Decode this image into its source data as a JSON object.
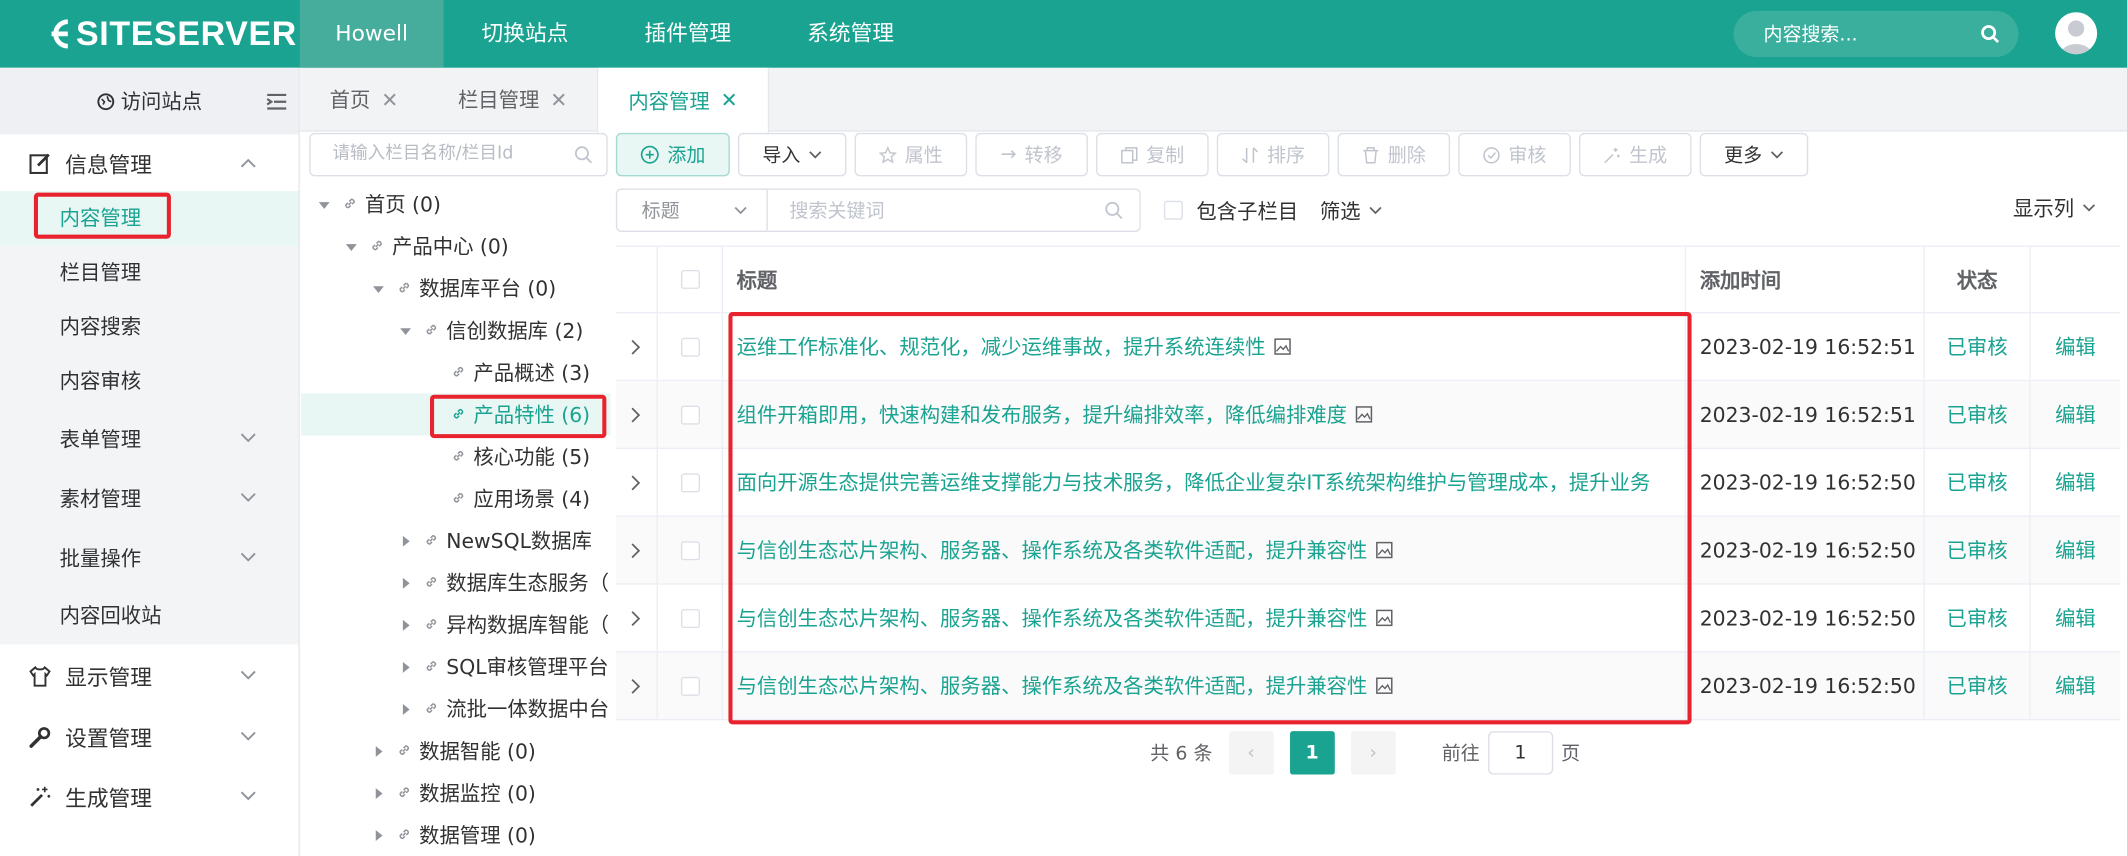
{
  "brand": {
    "logo_text": "SITESERVER"
  },
  "topnav": {
    "items": [
      "Howell",
      "切换站点",
      "插件管理",
      "系统管理"
    ]
  },
  "global_search": {
    "placeholder": "内容搜索..."
  },
  "sidebar": {
    "visit": "访问站点",
    "sections": [
      {
        "label": "信息管理",
        "icon": "edit-icon",
        "expanded": true
      },
      {
        "label": "显示管理",
        "icon": "shirt-icon"
      },
      {
        "label": "设置管理",
        "icon": "wrench-icon"
      },
      {
        "label": "生成管理",
        "icon": "magic-wand-icon"
      }
    ],
    "info_items": [
      "内容管理",
      "栏目管理",
      "内容搜索",
      "内容审核"
    ],
    "info_groups": [
      "表单管理",
      "素材管理",
      "批量操作"
    ],
    "recycle": "内容回收站"
  },
  "tabs": [
    {
      "label": "首页"
    },
    {
      "label": "栏目管理"
    },
    {
      "label": "内容管理",
      "active": true
    }
  ],
  "tree": {
    "search_placeholder": "请输入栏目名称/栏目Id",
    "nodes": [
      {
        "label": "首页 (0)",
        "level": 0,
        "arrow": "down"
      },
      {
        "label": "产品中心 (0)",
        "level": 1,
        "arrow": "down"
      },
      {
        "label": "数据库平台 (0)",
        "level": 2,
        "arrow": "down"
      },
      {
        "label": "信创数据库 (2)",
        "level": 3,
        "arrow": "down"
      },
      {
        "label": "产品概述 (3)",
        "level": 4,
        "arrow": "none"
      },
      {
        "label": "产品特性 (6)",
        "level": 4,
        "arrow": "none",
        "selected": true
      },
      {
        "label": "核心功能 (5)",
        "level": 4,
        "arrow": "none"
      },
      {
        "label": "应用场景 (4)",
        "level": 4,
        "arrow": "none"
      },
      {
        "label": "NewSQL数据库",
        "level": 3,
        "arrow": "right"
      },
      {
        "label": "数据库生态服务（",
        "level": 3,
        "arrow": "right"
      },
      {
        "label": "异构数据库智能（",
        "level": 3,
        "arrow": "right"
      },
      {
        "label": "SQL审核管理平台",
        "level": 3,
        "arrow": "right"
      },
      {
        "label": "流批一体数据中台",
        "level": 3,
        "arrow": "right"
      },
      {
        "label": "数据智能 (0)",
        "level": 2,
        "arrow": "right"
      },
      {
        "label": "数据监控 (0)",
        "level": 2,
        "arrow": "right"
      },
      {
        "label": "数据管理 (0)",
        "level": 2,
        "arrow": "right"
      }
    ]
  },
  "toolbar": {
    "add": "添加",
    "import": "导入",
    "attr": "属性",
    "move": "转移",
    "copy": "复制",
    "sort": "排序",
    "delete": "删除",
    "audit": "审核",
    "generate": "生成",
    "more": "更多"
  },
  "filter": {
    "field": "标题",
    "keyword_placeholder": "搜索关键词",
    "include_children": "包含子栏目",
    "filter_label": "筛选",
    "columns_label": "显示列"
  },
  "table": {
    "headers": {
      "title": "标题",
      "time": "添加时间",
      "status": "状态"
    },
    "rows": [
      {
        "title": "运维工作标准化、规范化，减少运维事故，提升系统连续性",
        "time": "2023-02-19 16:52:51",
        "status": "已审核",
        "action": "编辑",
        "has_image": true
      },
      {
        "title": "组件开箱即用，快速构建和发布服务，提升编排效率，降低编排难度",
        "time": "2023-02-19 16:52:51",
        "status": "已审核",
        "action": "编辑",
        "has_image": true
      },
      {
        "title": "面向开源生态提供完善运维支撑能力与技术服务，降低企业复杂IT系统架构维护与管理成本，提升业务",
        "time": "2023-02-19 16:52:50",
        "status": "已审核",
        "action": "编辑",
        "has_image": false
      },
      {
        "title": "与信创生态芯片架构、服务器、操作系统及各类软件适配，提升兼容性",
        "time": "2023-02-19 16:52:50",
        "status": "已审核",
        "action": "编辑",
        "has_image": true
      },
      {
        "title": "与信创生态芯片架构、服务器、操作系统及各类软件适配，提升兼容性",
        "time": "2023-02-19 16:52:50",
        "status": "已审核",
        "action": "编辑",
        "has_image": true
      },
      {
        "title": "与信创生态芯片架构、服务器、操作系统及各类软件适配，提升兼容性",
        "time": "2023-02-19 16:52:50",
        "status": "已审核",
        "action": "编辑",
        "has_image": true
      }
    ]
  },
  "pagination": {
    "total": "共 6 条",
    "current": "1",
    "goto_label": "前往",
    "goto_value": "1",
    "page_unit": "页"
  },
  "colors": {
    "accent": "#1aa391",
    "highlight": "#e8232d"
  }
}
